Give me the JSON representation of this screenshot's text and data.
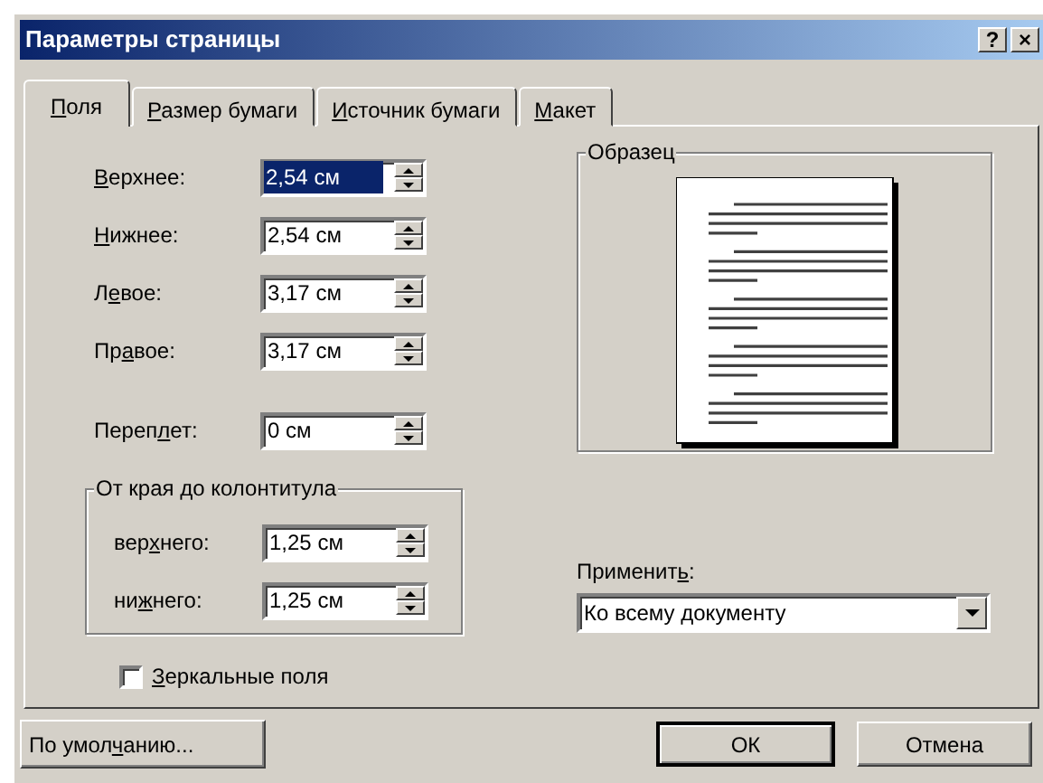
{
  "window": {
    "title": "Параметры страницы",
    "help": "?",
    "close": "×"
  },
  "tabs": [
    {
      "label": {
        "key": "П",
        "post": "оля"
      },
      "selected": true
    },
    {
      "label": {
        "key": "Р",
        "post": "азмер бумаги"
      },
      "selected": false
    },
    {
      "label": {
        "key": "И",
        "post": "сточник бумаги"
      },
      "selected": false
    },
    {
      "label": {
        "key": "М",
        "post": "акет"
      },
      "selected": false
    }
  ],
  "margins": [
    {
      "label": {
        "key": "В",
        "post": "ерхнее:"
      },
      "value": "2,54 см",
      "selected": true
    },
    {
      "label": {
        "key": "Н",
        "post": "ижнее:"
      },
      "value": "2,54 см",
      "selected": false
    },
    {
      "label": {
        "pre": "Л",
        "key": "е",
        "post": "вое:"
      },
      "value": "3,17 см",
      "selected": false
    },
    {
      "label": {
        "pre": "Пр",
        "key": "а",
        "post": "вое:"
      },
      "value": "3,17 см",
      "selected": false
    }
  ],
  "gutter": {
    "label": {
      "pre": "Переп",
      "key": "л",
      "post": "ет:"
    },
    "value": "0 см"
  },
  "header_footer": {
    "title": "От края до колонтитула",
    "fields": [
      {
        "label": {
          "pre": "вер",
          "key": "х",
          "post": "него:"
        },
        "value": "1,25 см"
      },
      {
        "label": {
          "pre": "ни",
          "key": "ж",
          "post": "него:"
        },
        "value": "1,25 см"
      }
    ]
  },
  "mirror_margins": {
    "label": {
      "key": "З",
      "post": "еркальные поля"
    },
    "checked": false
  },
  "preview": {
    "title": "Образец"
  },
  "apply": {
    "label": {
      "pre": "Применит",
      "key": "ь",
      "post": ":"
    },
    "value": "Ко всему документу"
  },
  "default_button": {
    "label": {
      "pre": "По умол",
      "key": "ч",
      "post": "анию..."
    }
  },
  "ok_button": "ОК",
  "cancel_button": "Отмена"
}
